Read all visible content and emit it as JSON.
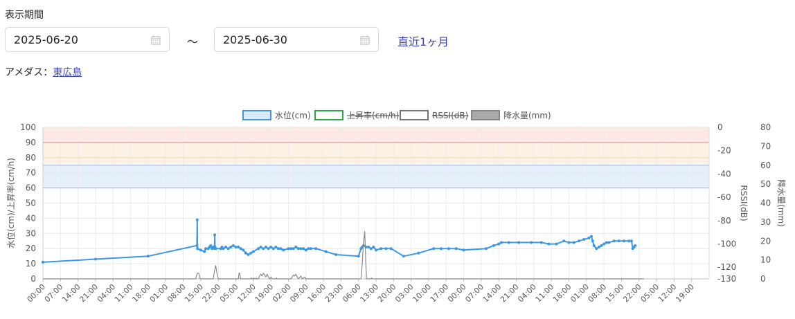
{
  "filter": {
    "period_label": "表示期間",
    "start_date": "2025-06-20",
    "separator": "～",
    "end_date": "2025-06-30",
    "recent_link": "直近1ヶ月"
  },
  "amedas": {
    "label": "アメダス：",
    "station": "東広島"
  },
  "chart_data": {
    "type": "line",
    "legend": {
      "placement": "top",
      "items": [
        {
          "name": "水位(cm)",
          "color": "#3b97e3",
          "fill": "#dce9f7",
          "hidden": false
        },
        {
          "name": "上昇率(cm/h)",
          "color": "#28a745",
          "fill": "#ffffff",
          "hidden": true
        },
        {
          "name": "RSSI(dB)",
          "color": "#6c757d",
          "fill": "#ffffff",
          "hidden": true
        },
        {
          "name": "降水量(mm)",
          "color": "#888888",
          "fill": "#aaaaaa",
          "hidden": false
        }
      ]
    },
    "axes": {
      "y_left": {
        "label": "水位(cm)/上昇率(cm/h)",
        "min": 0,
        "max": 100,
        "ticks": [
          0,
          10,
          20,
          30,
          40,
          50,
          60,
          70,
          80,
          90,
          100
        ]
      },
      "y_rssi": {
        "label": "RSSI(dB)",
        "min": -130,
        "max": 0,
        "ticks": [
          0,
          -20,
          -40,
          -60,
          -80,
          -100,
          -120,
          -130
        ]
      },
      "y_rain": {
        "label": "降水量(mm)",
        "min": 0,
        "max": 80,
        "ticks": [
          0,
          10,
          20,
          30,
          40,
          50,
          60,
          70,
          80
        ]
      }
    },
    "x_ticks": [
      "00:00",
      "07:00",
      "14:00",
      "21:00",
      "04:00",
      "11:00",
      "18:00",
      "01:00",
      "08:00",
      "15:00",
      "22:00",
      "05:00",
      "12:00",
      "19:00",
      "02:00",
      "09:00",
      "16:00",
      "23:00",
      "06:00",
      "13:00",
      "20:00",
      "03:00",
      "10:00",
      "17:00",
      "00:00",
      "07:00",
      "14:00",
      "21:00",
      "04:00",
      "11:00",
      "18:00",
      "01:00",
      "08:00",
      "15:00",
      "22:00",
      "05:00",
      "12:00",
      "19:00"
    ],
    "x_unit_hours": 7,
    "grid": true,
    "bands": [
      {
        "from": 90,
        "to": 100,
        "color": "#fde8e6"
      },
      {
        "from": 75,
        "to": 90,
        "color": "#fdf1e4"
      },
      {
        "from": 60,
        "to": 75,
        "color": "#e6effc"
      }
    ],
    "threshold_lines": [
      {
        "value": 90,
        "color": "#e89a97"
      },
      {
        "value": 80,
        "color": "#f3d9b5"
      },
      {
        "value": 75,
        "color": "#a9c4ea"
      },
      {
        "value": 60,
        "color": "#a9c4ea"
      }
    ],
    "series": [
      {
        "name": "水位(cm)",
        "axis": "y_left",
        "color": "#3b97e3",
        "points": [
          [
            0,
            11
          ],
          [
            21,
            13
          ],
          [
            42,
            15
          ],
          [
            61.5,
            22
          ],
          [
            61.6,
            39
          ],
          [
            61.7,
            20
          ],
          [
            63,
            19
          ],
          [
            64.5,
            18
          ],
          [
            65,
            20
          ],
          [
            66,
            20
          ],
          [
            66.5,
            21
          ],
          [
            67,
            22
          ],
          [
            67.5,
            20
          ],
          [
            68,
            21
          ],
          [
            68.5,
            20
          ],
          [
            68.6,
            29
          ],
          [
            68.7,
            21
          ],
          [
            69,
            20
          ],
          [
            71,
            20
          ],
          [
            71.5,
            21
          ],
          [
            72,
            20
          ],
          [
            73,
            21
          ],
          [
            74,
            20
          ],
          [
            75,
            21
          ],
          [
            76,
            22
          ],
          [
            77,
            21
          ],
          [
            78,
            21
          ],
          [
            79,
            20
          ],
          [
            80,
            19
          ],
          [
            81,
            17
          ],
          [
            82,
            16
          ],
          [
            83,
            17
          ],
          [
            84,
            18
          ],
          [
            86,
            20
          ],
          [
            87,
            21
          ],
          [
            88,
            20
          ],
          [
            89,
            21
          ],
          [
            90,
            20
          ],
          [
            91,
            21
          ],
          [
            92,
            20
          ],
          [
            93,
            21
          ],
          [
            94,
            20
          ],
          [
            95,
            20
          ],
          [
            96,
            19
          ],
          [
            98,
            20
          ],
          [
            99,
            20
          ],
          [
            100,
            20
          ],
          [
            101,
            21
          ],
          [
            102,
            20
          ],
          [
            103,
            20
          ],
          [
            104,
            20
          ],
          [
            105,
            19
          ],
          [
            106,
            20
          ],
          [
            107,
            20
          ],
          [
            109,
            20
          ],
          [
            113,
            18
          ],
          [
            117,
            16
          ],
          [
            126,
            15
          ],
          [
            127,
            20
          ],
          [
            127.5,
            21
          ],
          [
            128,
            22
          ],
          [
            129,
            21
          ],
          [
            130,
            21
          ],
          [
            131,
            20
          ],
          [
            132,
            21
          ],
          [
            133,
            19
          ],
          [
            135,
            20
          ],
          [
            137,
            20
          ],
          [
            139,
            20
          ],
          [
            144,
            15
          ],
          [
            150,
            17
          ],
          [
            156,
            20
          ],
          [
            159,
            20
          ],
          [
            162,
            20
          ],
          [
            165,
            20
          ],
          [
            168,
            19
          ],
          [
            177,
            20
          ],
          [
            180,
            22
          ],
          [
            182,
            23
          ],
          [
            183,
            24
          ],
          [
            186,
            24
          ],
          [
            190,
            24
          ],
          [
            195,
            24
          ],
          [
            199,
            24
          ],
          [
            202,
            23
          ],
          [
            205,
            23
          ],
          [
            208,
            25
          ],
          [
            210,
            24
          ],
          [
            212,
            24
          ],
          [
            214,
            25
          ],
          [
            216,
            26
          ],
          [
            218,
            27
          ],
          [
            219,
            28
          ],
          [
            219.5,
            25
          ],
          [
            220,
            22
          ],
          [
            221,
            20
          ],
          [
            222,
            21
          ],
          [
            223,
            22
          ],
          [
            224,
            23
          ],
          [
            225,
            24
          ],
          [
            226,
            24
          ],
          [
            228,
            25
          ],
          [
            230,
            25
          ],
          [
            232,
            25
          ],
          [
            234,
            25
          ],
          [
            235,
            25
          ],
          [
            235.5,
            20
          ],
          [
            236,
            21
          ],
          [
            236.5,
            22
          ]
        ]
      },
      {
        "name": "降水量(mm)",
        "axis": "y_rain",
        "color": "#888888",
        "points": [
          [
            0,
            0
          ],
          [
            61,
            0
          ],
          [
            61.6,
            3
          ],
          [
            62.2,
            3
          ],
          [
            62.8,
            0
          ],
          [
            68,
            0
          ],
          [
            68.5,
            4
          ],
          [
            69,
            7
          ],
          [
            69.5,
            3
          ],
          [
            70,
            0
          ],
          [
            78,
            0
          ],
          [
            78.3,
            3
          ],
          [
            78.6,
            3
          ],
          [
            78.9,
            0
          ],
          [
            83,
            0
          ],
          [
            83.2,
            0.5
          ],
          [
            83.4,
            0
          ],
          [
            84,
            0
          ],
          [
            84.2,
            0.5
          ],
          [
            84.4,
            0
          ],
          [
            85,
            0
          ],
          [
            85.2,
            0.5
          ],
          [
            85.4,
            0
          ],
          [
            86,
            0
          ],
          [
            86.5,
            1.5
          ],
          [
            87,
            2.5
          ],
          [
            87.5,
            1.5
          ],
          [
            88,
            3
          ],
          [
            88.5,
            2
          ],
          [
            89,
            1
          ],
          [
            89.5,
            2.5
          ],
          [
            90,
            1
          ],
          [
            90.5,
            0
          ],
          [
            91,
            1
          ],
          [
            91.5,
            0
          ],
          [
            93,
            0
          ],
          [
            93.2,
            0.5
          ],
          [
            93.4,
            0
          ],
          [
            99,
            0
          ],
          [
            99.5,
            1
          ],
          [
            100,
            2
          ],
          [
            100.5,
            1.5
          ],
          [
            101,
            2.5
          ],
          [
            101.5,
            1
          ],
          [
            102,
            0
          ],
          [
            103,
            1.5
          ],
          [
            103.5,
            0
          ],
          [
            104.5,
            1
          ],
          [
            105,
            0
          ],
          [
            127,
            0
          ],
          [
            127.5,
            8
          ],
          [
            128,
            19
          ],
          [
            128.5,
            25
          ],
          [
            129,
            6
          ],
          [
            129.2,
            0
          ],
          [
            131,
            0
          ],
          [
            131.2,
            0.5
          ],
          [
            131.4,
            0
          ],
          [
            240,
            0
          ]
        ]
      }
    ]
  }
}
